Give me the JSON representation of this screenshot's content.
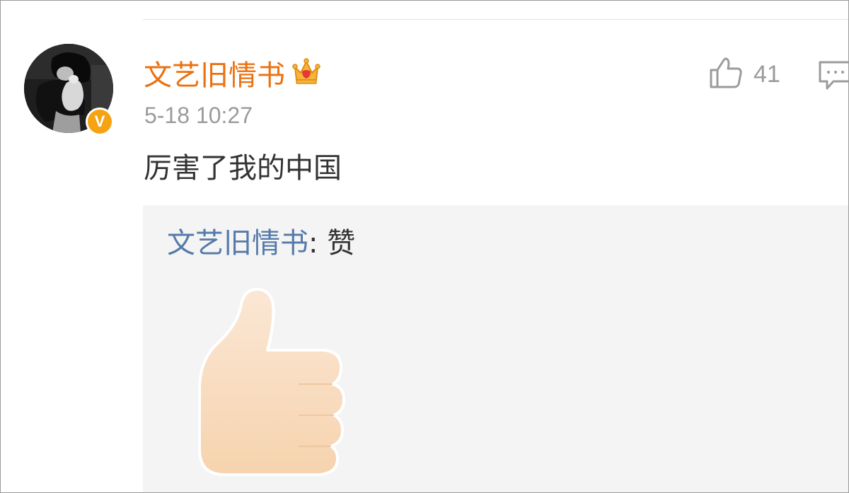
{
  "comment": {
    "username": "文艺旧情书",
    "timestamp": "5-18 10:27",
    "text": "厉害了我的中国",
    "like_count": "41",
    "verified_badge": "V",
    "icons": {
      "avatar": "avatar",
      "verified": "verified-badge",
      "crown": "crown-icon",
      "like": "thumbs-up-outline-icon",
      "reply": "comment-bubble-icon"
    },
    "colors": {
      "username": "#eb7110",
      "timestamp": "#9b9b9b",
      "reply_author": "#557aa9",
      "badge": "#f6a313",
      "reply_bg": "#f4f4f4"
    }
  },
  "reply": {
    "author": "文艺旧情书",
    "separator": ": ",
    "text": "赞",
    "emoji": "thumbs-up-emoji"
  }
}
